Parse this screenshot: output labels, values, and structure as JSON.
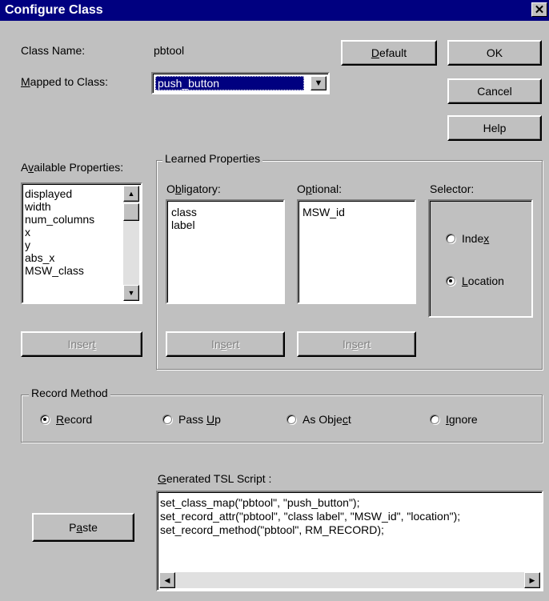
{
  "window": {
    "title": "Configure Class",
    "close_glyph": "✕"
  },
  "class_name": {
    "label": "Class Name:",
    "value": "pbtool"
  },
  "mapped": {
    "label": "Mapped to Class:",
    "value": "push_button"
  },
  "buttons": {
    "default": "Default",
    "ok": "OK",
    "cancel": "Cancel",
    "help": "Help",
    "paste": "Paste"
  },
  "available": {
    "label": "Available Properties:",
    "items": [
      "displayed",
      "width",
      "num_columns",
      "x",
      "y",
      "abs_x",
      "MSW_class"
    ],
    "insert": "Insert"
  },
  "learned": {
    "legend": "Learned Properties",
    "obligatory_label": "Obligatory:",
    "obligatory_items": [
      "class",
      "label"
    ],
    "optional_label": "Optional:",
    "optional_items": [
      "MSW_id"
    ],
    "selector_label": "Selector:",
    "selector_options": [
      "Index",
      "Location"
    ],
    "selector_selected": "Location",
    "insert": "Insert"
  },
  "record_method": {
    "legend": "Record Method",
    "options": [
      "Record",
      "Pass Up",
      "As Object",
      "Ignore"
    ],
    "selected": "Record"
  },
  "tsl": {
    "label": "Generated TSL Script :",
    "lines": [
      "set_class_map(\"pbtool\", \"push_button\");",
      "set_record_attr(\"pbtool\", \"class label\", \"MSW_id\", \"location\");",
      "set_record_method(\"pbtool\", RM_RECORD);"
    ]
  },
  "icons": {
    "close": "close-icon",
    "dropdown": "chevron-down-icon",
    "scroll_up": "arrow-up-icon",
    "scroll_down": "arrow-down-icon",
    "scroll_left": "arrow-left-icon",
    "scroll_right": "arrow-right-icon"
  },
  "colors": {
    "titlebar": "#000080",
    "face": "#c0c0c0",
    "selection": "#000080"
  }
}
